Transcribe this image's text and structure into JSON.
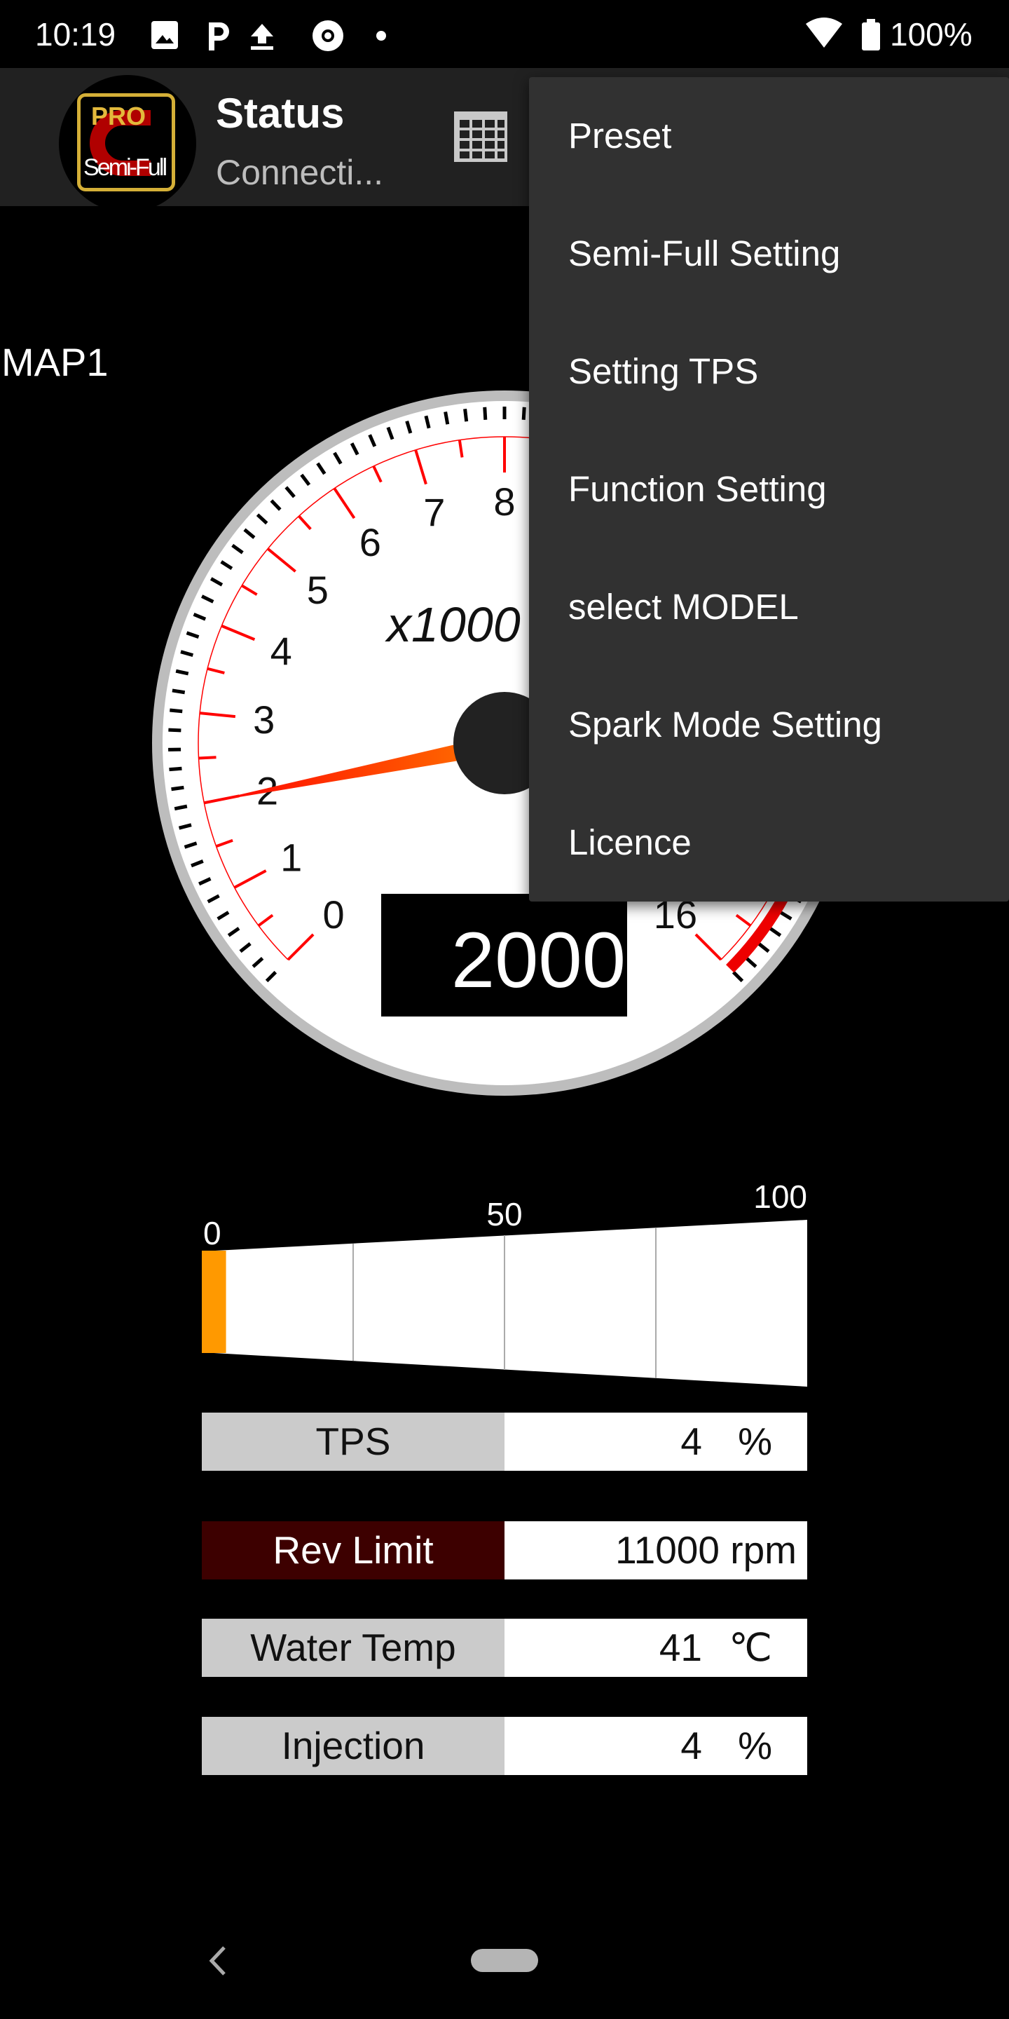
{
  "status_bar": {
    "time": "10:19",
    "battery": "100%",
    "icons": [
      "image-icon",
      "parking-icon",
      "upload-icon",
      "chrome-icon",
      "dot-icon",
      "wifi-icon",
      "battery-icon"
    ]
  },
  "app_bar": {
    "logo_text": [
      "PRO",
      "Semi-Full"
    ],
    "title": "Status",
    "subtitle": "Connecti...",
    "table_icon": "grid-icon"
  },
  "menu": {
    "items": [
      "Preset",
      "Semi-Full Setting",
      "Setting TPS",
      "Function Setting",
      "select MODEL",
      "Spark Mode Setting",
      "Licence"
    ]
  },
  "map_label": "MAP1",
  "tachometer": {
    "unit_label": "x1000",
    "min": 0,
    "max": 16,
    "visible_tick_labels": [
      "0",
      "1",
      "2",
      "3",
      "4",
      "5",
      "6",
      "7",
      "8",
      "16"
    ],
    "needle_value": 2,
    "digital_readout": "2000",
    "colors": {
      "ticks": "#ff0000",
      "needle": "#ff3300",
      "redline": "#ee0000"
    }
  },
  "tps_bar": {
    "labels": [
      "0",
      "50",
      "100"
    ],
    "value_percent": 4,
    "fill_color": "#ff9900"
  },
  "readouts": [
    {
      "label": "TPS",
      "value": "4",
      "unit": "%",
      "label_bg": "#cbcbcb",
      "label_color": "#111111"
    },
    {
      "label": "Rev Limit",
      "value": "11000 rpm",
      "unit": "",
      "label_bg": "#3d0000",
      "label_color": "#ffffff"
    },
    {
      "label": "Water Temp",
      "value": "41",
      "unit": "℃",
      "label_bg": "#cbcbcb",
      "label_color": "#111111"
    },
    {
      "label": "Injection",
      "value": "4",
      "unit": "%",
      "label_bg": "#cbcbcb",
      "label_color": "#111111"
    }
  ],
  "nav_bar": {
    "icons": [
      "back-icon",
      "home-pill"
    ]
  }
}
